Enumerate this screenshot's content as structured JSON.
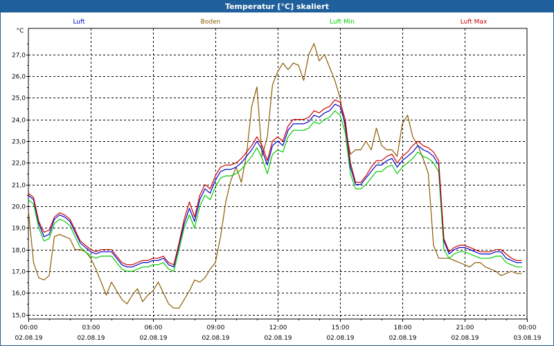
{
  "window": {
    "title": "Temperatur [°C] skaliert"
  },
  "chart_data": {
    "type": "line",
    "title": "Temperatur [°C] skaliert",
    "ylabel": "°C",
    "xlabel": "",
    "ylim": [
      14.8,
      28.2
    ],
    "xlim": [
      0,
      24
    ],
    "grid": true,
    "legend_position": "top",
    "y_ticks": [
      "15,0",
      "16,0",
      "17,0",
      "18,0",
      "19,0",
      "20,0",
      "21,0",
      "22,0",
      "23,0",
      "24,0",
      "25,0",
      "26,0",
      "27,0"
    ],
    "x_ticks": [
      {
        "x": 0,
        "time": "00:00",
        "date": "02.08.19"
      },
      {
        "x": 3,
        "time": "03:00",
        "date": "02.08.19"
      },
      {
        "x": 6,
        "time": "06:00",
        "date": "02.08.19"
      },
      {
        "x": 9,
        "time": "09:00",
        "date": "02.08.19"
      },
      {
        "x": 12,
        "time": "12:00",
        "date": "02.08.19"
      },
      {
        "x": 15,
        "time": "15:00",
        "date": "02.08.19"
      },
      {
        "x": 18,
        "time": "18:00",
        "date": "02.08.19"
      },
      {
        "x": 21,
        "time": "21:00",
        "date": "02.08.19"
      },
      {
        "x": 24,
        "time": "00:00",
        "date": "03.08.19"
      }
    ],
    "x": [
      0,
      0.25,
      0.5,
      0.75,
      1,
      1.25,
      1.5,
      1.75,
      2,
      2.25,
      2.5,
      2.75,
      3,
      3.25,
      3.5,
      3.75,
      4,
      4.25,
      4.5,
      4.75,
      5,
      5.25,
      5.5,
      5.75,
      6,
      6.25,
      6.5,
      6.75,
      7,
      7.25,
      7.5,
      7.75,
      8,
      8.25,
      8.5,
      8.75,
      9,
      9.25,
      9.5,
      9.75,
      10,
      10.25,
      10.5,
      10.75,
      11,
      11.25,
      11.5,
      11.75,
      12,
      12.25,
      12.5,
      12.75,
      13,
      13.25,
      13.5,
      13.75,
      14,
      14.25,
      14.5,
      14.75,
      15,
      15.25,
      15.5,
      15.75,
      16,
      16.25,
      16.5,
      16.75,
      17,
      17.25,
      17.5,
      17.75,
      18,
      18.25,
      18.5,
      18.75,
      19,
      19.25,
      19.5,
      19.75,
      20,
      20.25,
      20.5,
      20.75,
      21,
      21.25,
      21.5,
      21.75,
      22,
      22.25,
      22.5,
      22.75,
      23,
      23.25,
      23.5,
      23.75
    ],
    "series": [
      {
        "name": "Luft",
        "color": "#0000cc",
        "values": [
          20.5,
          20.3,
          19.2,
          18.6,
          18.7,
          19.4,
          19.6,
          19.5,
          19.3,
          18.8,
          18.3,
          18.1,
          17.9,
          17.8,
          17.9,
          17.9,
          17.9,
          17.6,
          17.3,
          17.2,
          17.2,
          17.3,
          17.4,
          17.4,
          17.5,
          17.5,
          17.6,
          17.3,
          17.2,
          18.2,
          19.2,
          19.9,
          19.3,
          20.3,
          20.8,
          20.6,
          21.2,
          21.6,
          21.7,
          21.7,
          21.8,
          22.0,
          22.3,
          22.6,
          23.0,
          22.6,
          21.9,
          22.8,
          23.0,
          22.8,
          23.5,
          23.8,
          23.8,
          23.8,
          23.9,
          24.2,
          24.1,
          24.3,
          24.4,
          24.7,
          24.6,
          23.8,
          21.8,
          21.0,
          21.0,
          21.3,
          21.6,
          21.9,
          21.9,
          22.1,
          22.2,
          21.8,
          22.1,
          22.3,
          22.5,
          22.8,
          22.6,
          22.5,
          22.3,
          21.9,
          18.4,
          17.8,
          18.0,
          18.1,
          18.1,
          18.0,
          17.9,
          17.8,
          17.8,
          17.8,
          17.9,
          17.9,
          17.6,
          17.5,
          17.4,
          17.4,
          17.3,
          17.3
        ]
      },
      {
        "name": "Boden",
        "color": "#8b5a00",
        "values": [
          19.8,
          17.4,
          16.7,
          16.6,
          16.8,
          18.6,
          18.7,
          18.6,
          18.5,
          18.0,
          18.0,
          17.9,
          17.6,
          17.1,
          16.5,
          15.9,
          16.5,
          16.1,
          15.7,
          15.5,
          15.9,
          16.2,
          15.6,
          15.9,
          16.1,
          16.5,
          16.0,
          15.5,
          15.3,
          15.3,
          15.7,
          16.1,
          16.6,
          16.5,
          16.7,
          17.1,
          17.4,
          18.6,
          20.2,
          21.2,
          21.8,
          21.1,
          22.4,
          24.6,
          25.5,
          22.3,
          23.2,
          25.6,
          26.2,
          26.6,
          26.3,
          26.6,
          26.5,
          25.8,
          27.0,
          27.5,
          26.7,
          27.0,
          26.4,
          25.8,
          25.0,
          23.6,
          22.4,
          22.6,
          22.6,
          23.0,
          22.6,
          23.6,
          22.8,
          22.6,
          22.6,
          22.3,
          23.8,
          24.2,
          23.2,
          22.8,
          22.2,
          21.5,
          18.2,
          17.6,
          17.6,
          17.6,
          17.5,
          17.4,
          17.3,
          17.2,
          17.4,
          17.4,
          17.2,
          17.1,
          17.0,
          16.8,
          16.9,
          17.0,
          16.9,
          16.9,
          16.9,
          16.9
        ]
      },
      {
        "name": "Luft Min",
        "color": "#00cc00",
        "values": [
          20.3,
          20.1,
          19.0,
          18.4,
          18.5,
          19.2,
          19.4,
          19.3,
          19.1,
          18.6,
          18.1,
          17.9,
          17.7,
          17.6,
          17.7,
          17.7,
          17.7,
          17.4,
          17.1,
          17.0,
          17.0,
          17.1,
          17.2,
          17.2,
          17.3,
          17.3,
          17.4,
          17.1,
          17.0,
          18.0,
          19.0,
          19.6,
          19.0,
          20.0,
          20.5,
          20.3,
          20.9,
          21.3,
          21.4,
          21.4,
          21.5,
          21.7,
          22.0,
          22.3,
          22.7,
          22.2,
          21.5,
          22.4,
          22.6,
          22.5,
          23.2,
          23.5,
          23.5,
          23.5,
          23.6,
          23.9,
          23.8,
          24.0,
          24.1,
          24.4,
          24.2,
          23.4,
          21.5,
          20.8,
          20.8,
          21.0,
          21.3,
          21.6,
          21.6,
          21.8,
          21.9,
          21.5,
          21.8,
          22.0,
          22.2,
          22.5,
          22.3,
          22.2,
          22.0,
          21.6,
          18.0,
          17.6,
          17.8,
          17.9,
          17.9,
          17.8,
          17.7,
          17.6,
          17.6,
          17.6,
          17.7,
          17.7,
          17.4,
          17.3,
          17.2,
          17.2,
          17.1,
          17.1
        ]
      },
      {
        "name": "Luft Max",
        "color": "#cc0000",
        "values": [
          20.6,
          20.4,
          19.3,
          18.8,
          18.9,
          19.5,
          19.7,
          19.6,
          19.4,
          18.9,
          18.4,
          18.2,
          18.0,
          17.9,
          18.0,
          18.0,
          18.0,
          17.7,
          17.4,
          17.3,
          17.3,
          17.4,
          17.5,
          17.5,
          17.6,
          17.6,
          17.7,
          17.4,
          17.3,
          18.3,
          19.4,
          20.2,
          19.5,
          20.5,
          21.0,
          20.8,
          21.4,
          21.8,
          21.9,
          21.9,
          22.0,
          22.2,
          22.5,
          22.8,
          23.2,
          22.8,
          22.1,
          23.0,
          23.2,
          23.0,
          23.7,
          24.0,
          24.0,
          24.0,
          24.1,
          24.4,
          24.3,
          24.5,
          24.6,
          24.9,
          24.8,
          24.0,
          22.0,
          21.1,
          21.1,
          21.4,
          21.8,
          22.1,
          22.1,
          22.3,
          22.4,
          22.0,
          22.3,
          22.5,
          22.8,
          23.0,
          22.8,
          22.7,
          22.5,
          22.1,
          18.5,
          17.9,
          18.1,
          18.2,
          18.2,
          18.1,
          18.0,
          17.9,
          17.9,
          17.9,
          18.0,
          18.0,
          17.8,
          17.6,
          17.5,
          17.5,
          17.5,
          17.4
        ]
      }
    ]
  }
}
